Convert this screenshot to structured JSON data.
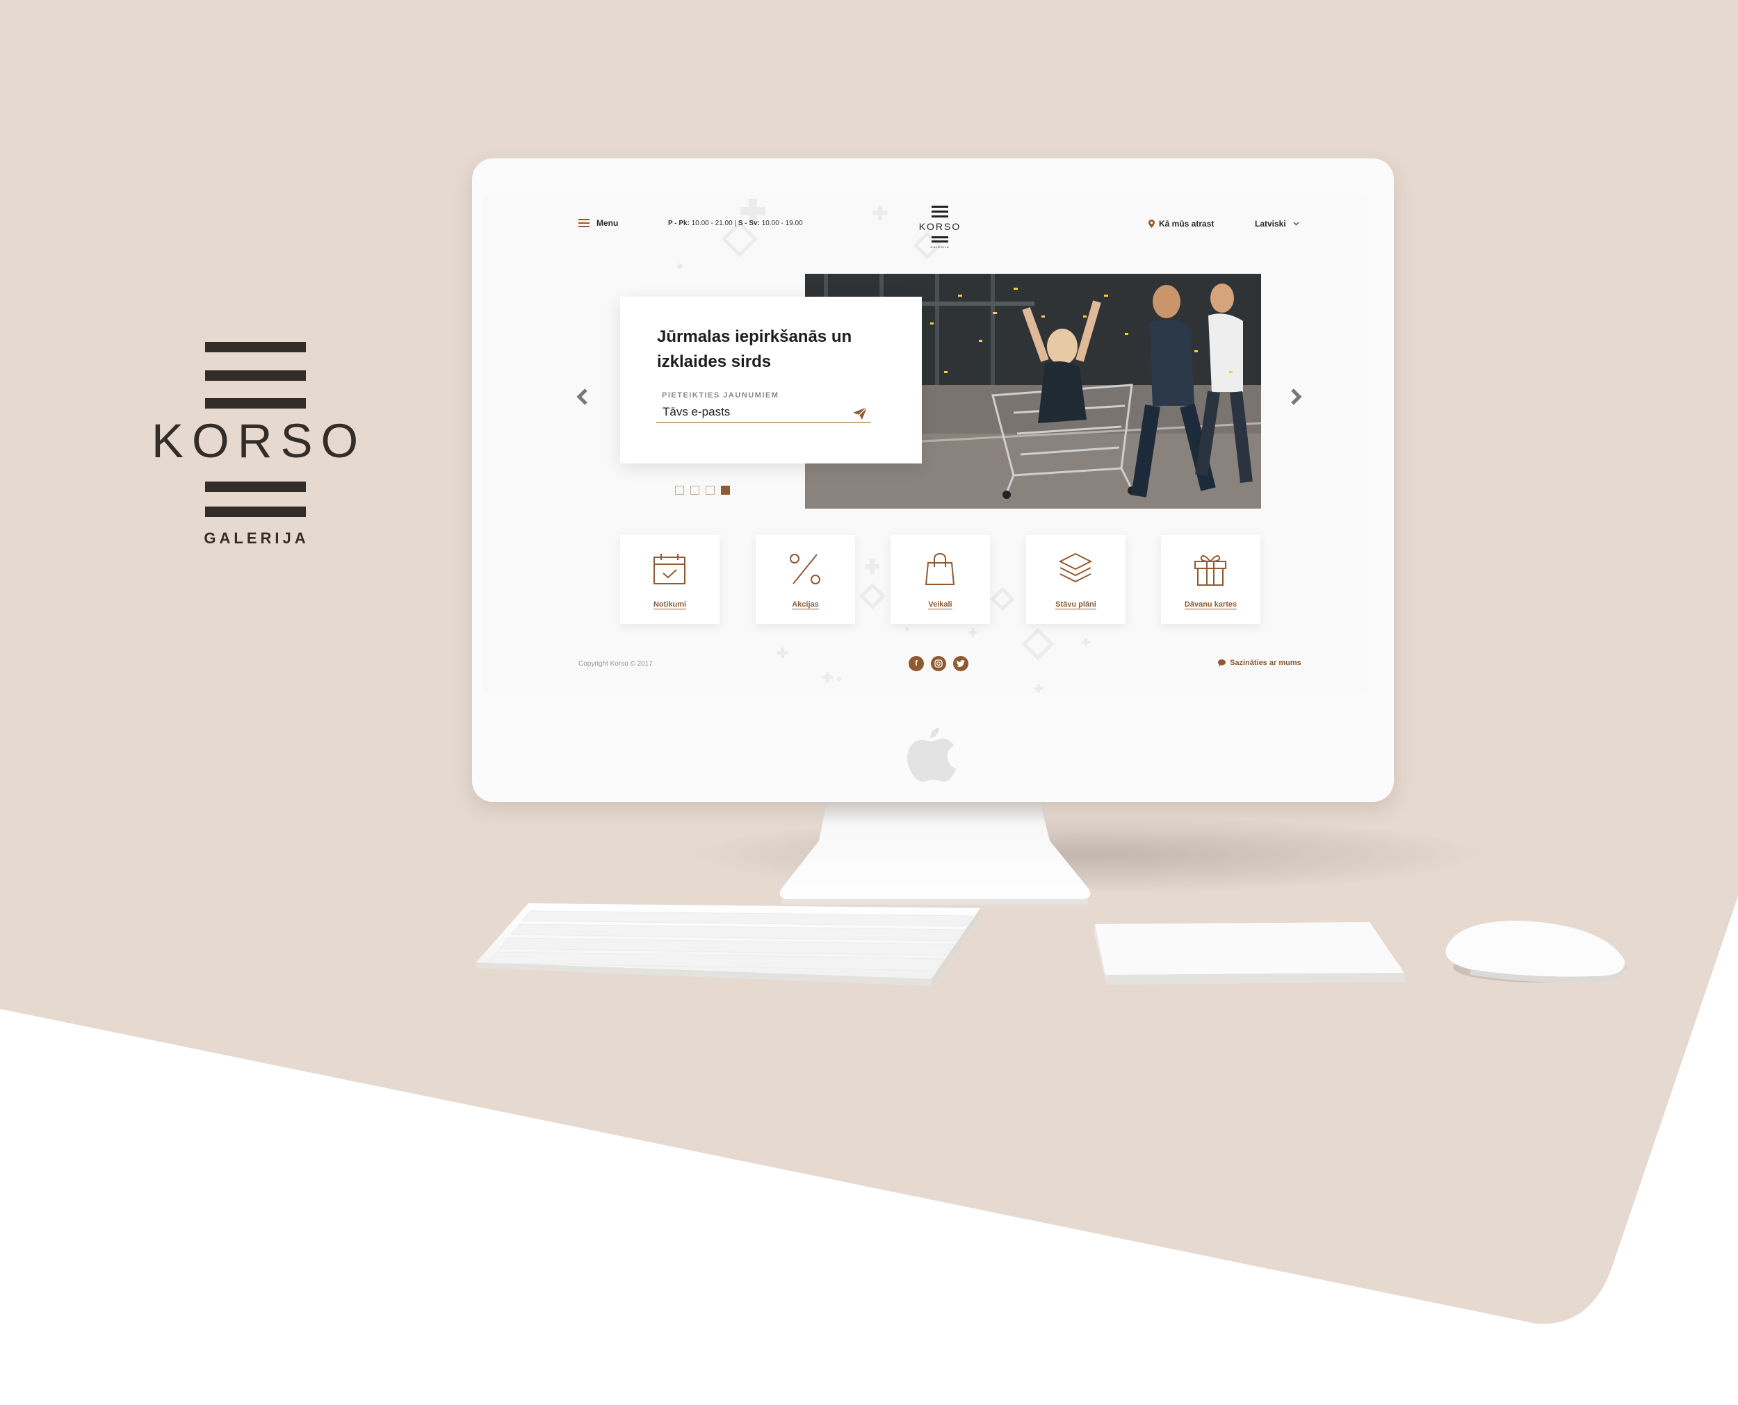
{
  "brand": {
    "name": "KORSO",
    "subtitle": "GALERIJA"
  },
  "colors": {
    "accent": "#8f5a33",
    "background_beige": "#e6dad0",
    "dark": "#332d2a"
  },
  "header": {
    "menu_label": "Menu",
    "hours": {
      "weekday_label": "P - Pk:",
      "weekday_time": "10.00 - 21.00",
      "separator": "|",
      "weekend_label": "S - Sv:",
      "weekend_time": "10.00 - 19.00"
    },
    "logo_text": "KORSO",
    "logo_subtext": "GALERIJA",
    "find_us": "Kā mūs atrast",
    "language": "Latviski"
  },
  "hero": {
    "title": "Jūrmalas iepirkšanās un izklaides sirds",
    "newsletter_label": "PIETEIKTIES JAUNUMIEM",
    "email_placeholder": "Tāvs e-pasts",
    "slides_total": 4,
    "active_slide": 4
  },
  "tiles": [
    {
      "label": "Notikumi",
      "icon": "calendar-check-icon"
    },
    {
      "label": "Akcijas",
      "icon": "percent-icon"
    },
    {
      "label": "Veikali",
      "icon": "shopping-bag-icon"
    },
    {
      "label": "Stāvu plāni",
      "icon": "layers-icon"
    },
    {
      "label": "Dāvanu kartes",
      "icon": "gift-icon"
    }
  ],
  "footer": {
    "copyright": "Copyright Korso © 2017",
    "socials": [
      "facebook-icon",
      "instagram-icon",
      "twitter-icon"
    ],
    "contact": "Sazināties ar mums"
  }
}
